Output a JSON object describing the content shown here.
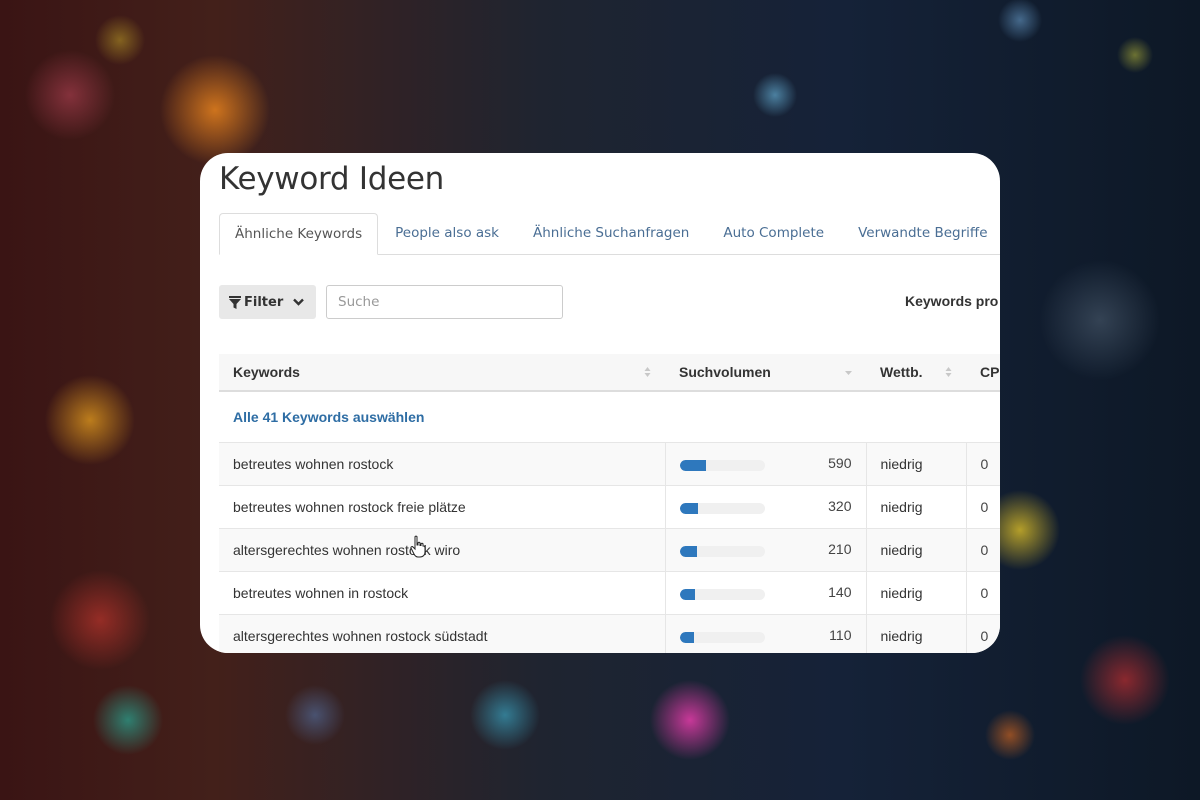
{
  "panel": {
    "title": "Keyword Ideen",
    "tabs": [
      {
        "label": "Ähnliche Keywords",
        "active": true
      },
      {
        "label": "People also ask",
        "active": false
      },
      {
        "label": "Ähnliche Suchanfragen",
        "active": false
      },
      {
        "label": "Auto Complete",
        "active": false
      },
      {
        "label": "Verwandte Begriffe",
        "active": false
      }
    ],
    "toolbar": {
      "filter_label": "Filter",
      "filter_icon": "funnel-icon",
      "dropdown_icon": "chevron-down-icon",
      "search_placeholder": "Suche",
      "search_value": "",
      "per_page_label": "Keywords pro"
    },
    "table": {
      "columns": [
        {
          "label": "Keywords",
          "sort": "sortable"
        },
        {
          "label": "Suchvolumen",
          "sort": "descending"
        },
        {
          "label": "Wettb.",
          "sort": "sortable"
        },
        {
          "label": "CP"
        }
      ],
      "select_all_label": "Alle 41 Keywords auswählen",
      "rows": [
        {
          "keyword": "betreutes wohnen rostock",
          "volume": "590",
          "volume_bar_fraction": 0.31,
          "competition": "niedrig",
          "cpc": "0"
        },
        {
          "keyword": "betreutes wohnen rostock freie plätze",
          "volume": "320",
          "volume_bar_fraction": 0.22,
          "competition": "niedrig",
          "cpc": "0"
        },
        {
          "keyword": "altersgerechtes wohnen rostock wiro",
          "volume": "210",
          "volume_bar_fraction": 0.2,
          "competition": "niedrig",
          "cpc": "0"
        },
        {
          "keyword": "betreutes wohnen in rostock",
          "volume": "140",
          "volume_bar_fraction": 0.18,
          "competition": "niedrig",
          "cpc": "0"
        },
        {
          "keyword": "altersgerechtes wohnen rostock südstadt",
          "volume": "110",
          "volume_bar_fraction": 0.17,
          "competition": "niedrig",
          "cpc": "0"
        }
      ]
    }
  },
  "colors": {
    "link": "#2e6da4",
    "tab_link": "#4a6e94",
    "bar_fill": "#2e78bd",
    "bar_track": "#f0f0f0"
  }
}
